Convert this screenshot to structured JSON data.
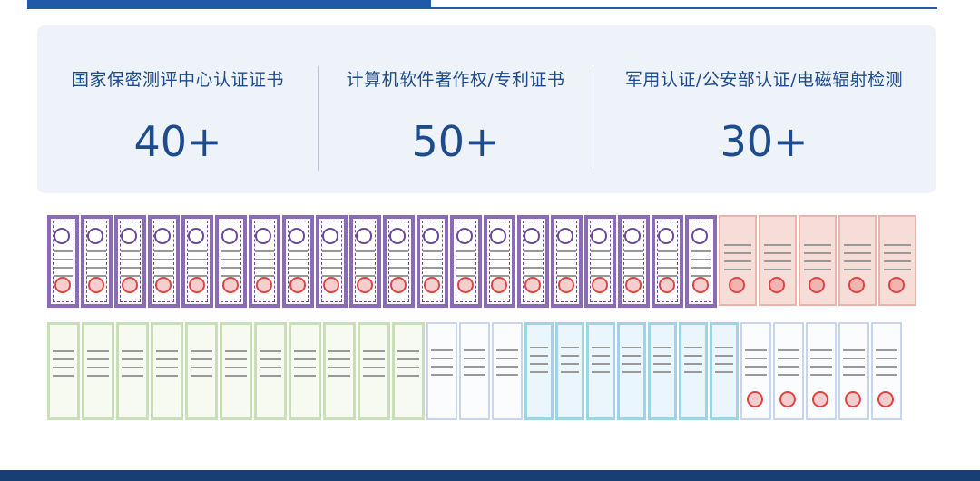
{
  "stats": [
    {
      "label": "国家保密测评中心认证证书",
      "value": "40+"
    },
    {
      "label": "计算机软件著作权/专利证书",
      "value": "50+"
    },
    {
      "label": "军用认证/公安部认证/电磁辐射检测",
      "value": "30+"
    }
  ],
  "colors": {
    "accent": "#1f5aa6",
    "panel": "#eef3f9",
    "text": "#1d4b8c"
  }
}
